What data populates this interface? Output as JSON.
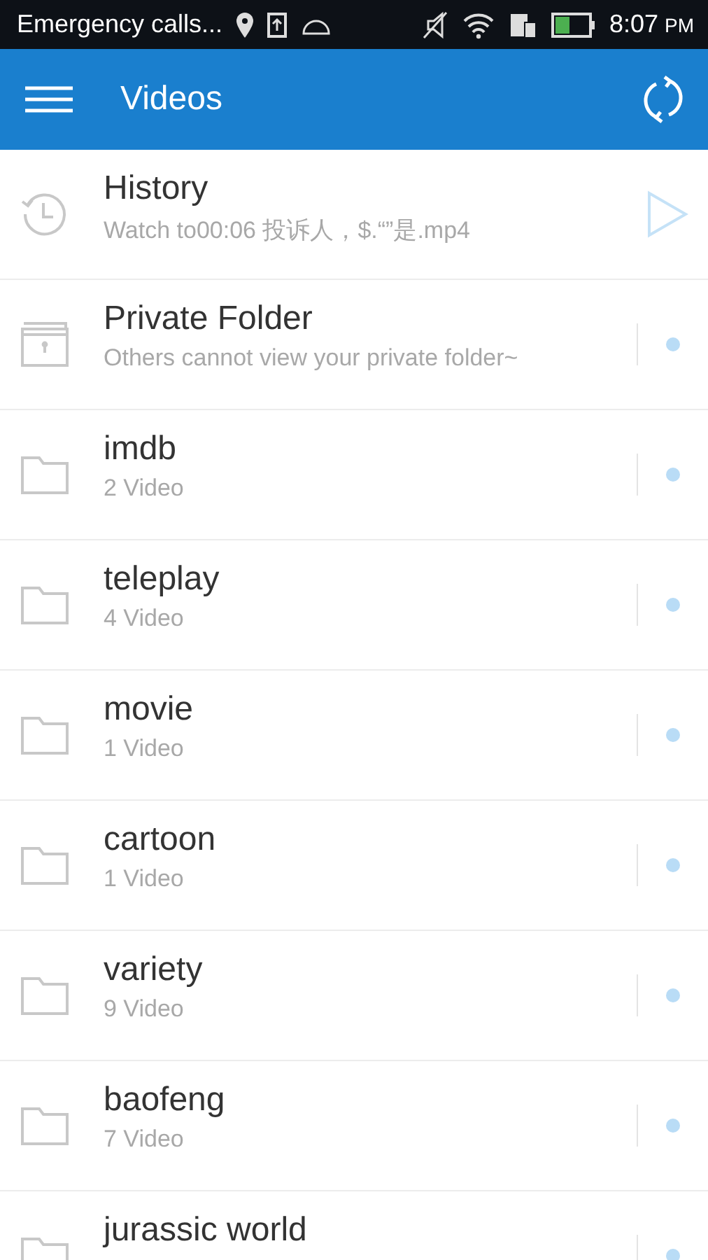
{
  "status_bar": {
    "carrier": "Emergency calls...",
    "time": "8:07",
    "ampm": "PM"
  },
  "app_bar": {
    "title": "Videos"
  },
  "items": [
    {
      "kind": "history",
      "title": "History",
      "subtitle": "Watch to00:06 投诉人，$.“”是.mp4"
    },
    {
      "kind": "private",
      "title": "Private Folder",
      "subtitle": "Others cannot view your private folder~"
    },
    {
      "kind": "folder",
      "title": "imdb",
      "subtitle": "2 Video"
    },
    {
      "kind": "folder",
      "title": "teleplay",
      "subtitle": "4 Video"
    },
    {
      "kind": "folder",
      "title": "movie",
      "subtitle": "1 Video"
    },
    {
      "kind": "folder",
      "title": "cartoon",
      "subtitle": "1 Video"
    },
    {
      "kind": "folder",
      "title": "variety",
      "subtitle": "9 Video"
    },
    {
      "kind": "folder",
      "title": "baofeng",
      "subtitle": "7 Video"
    },
    {
      "kind": "folder",
      "title": "jurassic world"
    }
  ]
}
